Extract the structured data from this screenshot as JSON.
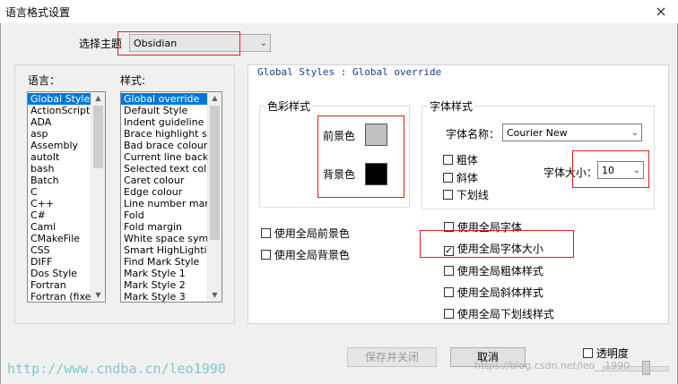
{
  "window": {
    "title": "语言格式设置",
    "close_glyph": "×"
  },
  "theme": {
    "label": "选择主题",
    "value": "Obsidian"
  },
  "languages": {
    "label": "语言：",
    "items": [
      "Global Styles",
      "ActionScript",
      "ADA",
      "asp",
      "Assembly",
      "autoIt",
      "bash",
      "Batch",
      "C",
      "C++",
      "C#",
      "Caml",
      "CMakeFile",
      "CSS",
      "DIFF",
      "Dos Style",
      "Fortran",
      "Fortran (fixed"
    ],
    "selected_index": 0
  },
  "styles": {
    "label": "样式:",
    "items": [
      "Global override",
      "Default Style",
      "Indent guideline sty",
      "Brace highlight style",
      "Bad brace colour",
      "Current line backgr",
      "Selected text colour",
      "Caret colour",
      "Edge colour",
      "Line number margin",
      "Fold",
      "Fold margin",
      "White space symbo",
      "Smart HighLighting",
      "Find Mark Style",
      "Mark Style 1",
      "Mark Style 2",
      "Mark Style 3"
    ],
    "selected_index": 0
  },
  "panel": {
    "header": "Global Styles : Global override"
  },
  "color_style": {
    "legend": "色彩样式",
    "fg_label": "前景色",
    "bg_label": "背景色",
    "fg_color": "#c0c0c0",
    "bg_color": "#000000"
  },
  "font_style": {
    "legend": "字体样式",
    "name_label": "字体名称：",
    "name_value": "Courier New",
    "bold": "粗体",
    "italic": "斜体",
    "underline": "下划线",
    "size_label": "字体大小：",
    "size_value": "10"
  },
  "global_checks_left": [
    "使用全局前景色",
    "使用全局背景色"
  ],
  "global_checks_right": [
    {
      "label": "使用全局字体",
      "checked": false
    },
    {
      "label": "使用全局字体大小",
      "checked": true
    },
    {
      "label": "使用全局粗体样式",
      "checked": false
    },
    {
      "label": "使用全局斜体样式",
      "checked": false
    },
    {
      "label": "使用全局下划线样式",
      "checked": false
    }
  ],
  "check_glyph": "✓",
  "buttons": {
    "save_close": "保存并关闭",
    "cancel": "取消"
  },
  "transparency": {
    "label": "透明度"
  },
  "watermarks": {
    "left": "http://www.cndba.cn/leo1990",
    "right": "https://blog.csdn.net/leo__1990"
  },
  "colors": {
    "highlight_red": "#e0201c",
    "selection_blue": "#0078d7",
    "header_blue": "#1a3a9a"
  }
}
